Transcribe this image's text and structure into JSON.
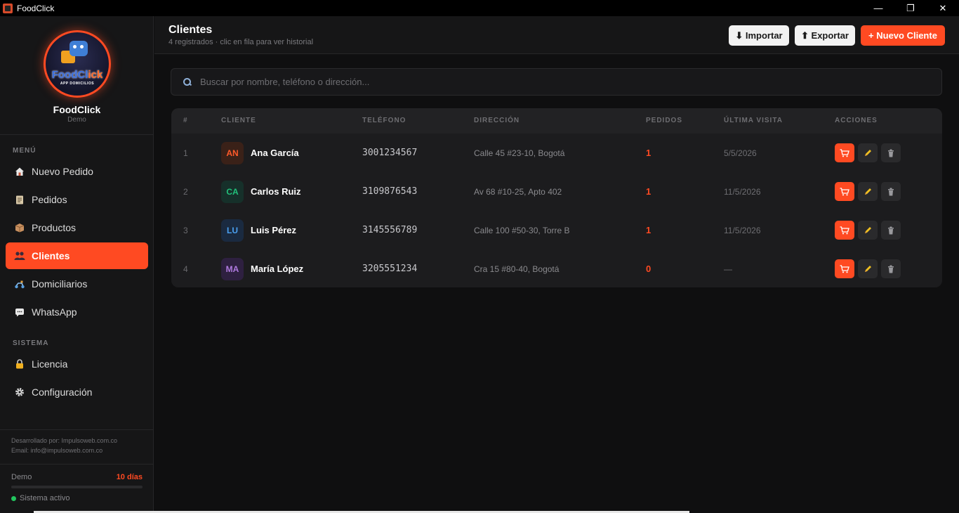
{
  "window": {
    "title": "FoodClick",
    "minimize": "—",
    "maximize": "❐",
    "close": "✕"
  },
  "brand": {
    "name": "FoodClick",
    "subtitle": "Demo",
    "logo_text_a": "FoodCl",
    "logo_text_b": "ick",
    "logo_sub": "APP DOMICILIOS"
  },
  "sidebar": {
    "menu_title": "MENÚ",
    "menu_items": [
      {
        "label": "Nuevo Pedido",
        "icon": "home-icon",
        "active": false
      },
      {
        "label": "Pedidos",
        "icon": "clipboard-icon",
        "active": false
      },
      {
        "label": "Productos",
        "icon": "box-icon",
        "active": false
      },
      {
        "label": "Clientes",
        "icon": "users-icon",
        "active": true
      },
      {
        "label": "Domiciliarios",
        "icon": "scooter-icon",
        "active": false
      },
      {
        "label": "WhatsApp",
        "icon": "chat-icon",
        "active": false
      }
    ],
    "system_title": "SISTEMA",
    "system_items": [
      {
        "label": "Licencia",
        "icon": "lock-icon"
      },
      {
        "label": "Configuración",
        "icon": "gear-icon"
      }
    ],
    "developer": "Desarrollado por: Impulsoweb.com.co",
    "email": "Email: info@impulsoweb.com.co",
    "demo_label": "Demo",
    "days_left": "10 días",
    "status": "Sistema activo",
    "accent": "#ff4a22"
  },
  "header": {
    "title": "Clientes",
    "subtitle": "4 registrados · clic en fila para ver historial",
    "import_label": "⬇ Importar",
    "export_label": "⬆ Exportar",
    "new_label": "+ Nuevo Cliente"
  },
  "search": {
    "placeholder": "Buscar por nombre, teléfono o dirección..."
  },
  "table": {
    "columns": [
      "#",
      "CLIENTE",
      "TELÉFONO",
      "DIRECCIÓN",
      "PEDIDOS",
      "ÚLTIMA VISITA",
      "ACCIONES"
    ],
    "rows": [
      {
        "num": "1",
        "initials": "AN",
        "name": "Ana García",
        "phone": "3001234567",
        "address": "Calle 45 #23-10, Bogotá",
        "orders": "1",
        "last_visit": "5/5/2026",
        "avatar_color": "#ff5a2a",
        "avatar_bg": "#3a2118"
      },
      {
        "num": "2",
        "initials": "CA",
        "name": "Carlos Ruiz",
        "phone": "3109876543",
        "address": "Av 68 #10-25, Apto 402",
        "orders": "1",
        "last_visit": "11/5/2026",
        "avatar_color": "#22c07a",
        "avatar_bg": "#16302a"
      },
      {
        "num": "3",
        "initials": "LU",
        "name": "Luis Pérez",
        "phone": "3145556789",
        "address": "Calle 100 #50-30, Torre B",
        "orders": "1",
        "last_visit": "11/5/2026",
        "avatar_color": "#4aa0f0",
        "avatar_bg": "#1a2a40"
      },
      {
        "num": "4",
        "initials": "MA",
        "name": "María López",
        "phone": "3205551234",
        "address": "Cra 15 #80-40, Bogotá",
        "orders": "0",
        "last_visit": "—",
        "avatar_color": "#b07ae0",
        "avatar_bg": "#2e2040"
      }
    ]
  }
}
